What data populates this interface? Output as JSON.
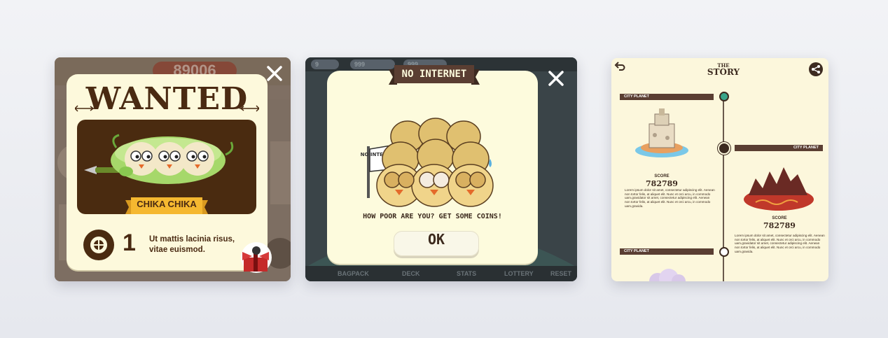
{
  "wanted_screen": {
    "background_score": "89006",
    "title": "WANTED",
    "character_name": "CHIKA CHIKA",
    "bounty_count": "1",
    "bounty_text": "Ut mattis lacinia risus, vitae euismod.",
    "close_icon": "close-icon",
    "colors": {
      "panel": "#fdf9dc",
      "text": "#4a2a12",
      "image_bg": "#4a2b10",
      "banner": "#f5b830"
    }
  },
  "no_internet_screen": {
    "top_pills": [
      "9",
      "999",
      "999"
    ],
    "title": "NO INTERNET",
    "sign_text": "NO INTERNET!!!",
    "message": "HOW POOR ARE YOU? GET SOME COINS!",
    "ok_label": "OK",
    "bottom_nav": [
      "BAGPACK",
      "DECK",
      "STATS",
      "LOTTERY",
      "RESET"
    ],
    "close_icon": "close-icon",
    "colors": {
      "panel": "#fdfbdd",
      "ribbon": "#5a3e32",
      "text": "#3c2a1e"
    }
  },
  "story_screen": {
    "title_small": "THE",
    "title": "STORY",
    "back_icon": "back-arrow-icon",
    "share_icon": "share-icon",
    "entries": [
      {
        "planet": "CITY PLANET",
        "score_label": "SCORE",
        "score": "782789",
        "text": "Lorem ipsum dolor sit amet, consectetur adipiscing elit. Aenean non tortor felis, at aliquet elit. Nunc et orci arcu, in commodo uam.gravidator sit amet, consectetur adipiscing elit. Aenean non tortor felis, at aliquet elit. Nunc et orci arcu, in commodo uam.gravida."
      },
      {
        "planet": "CITY PLANET",
        "score_label": "SCORE",
        "score": "782789",
        "text": "Lorem ipsum dolor sit amet, consectetur adipiscing elit. Aenean non tortor felis, at aliquet elit. Nunc et orci arcu, in commodo uam.gravidator sit amet, consectetur adipiscing elit. Aenean non tortor felis, at aliquet elit. Nunc et orci arcu, in commodo uam.gravida."
      },
      {
        "planet": "CITY PLANET"
      }
    ],
    "colors": {
      "bg": "#fcf7dc",
      "label": "#5a3e32",
      "accent": "#3aa589"
    }
  }
}
